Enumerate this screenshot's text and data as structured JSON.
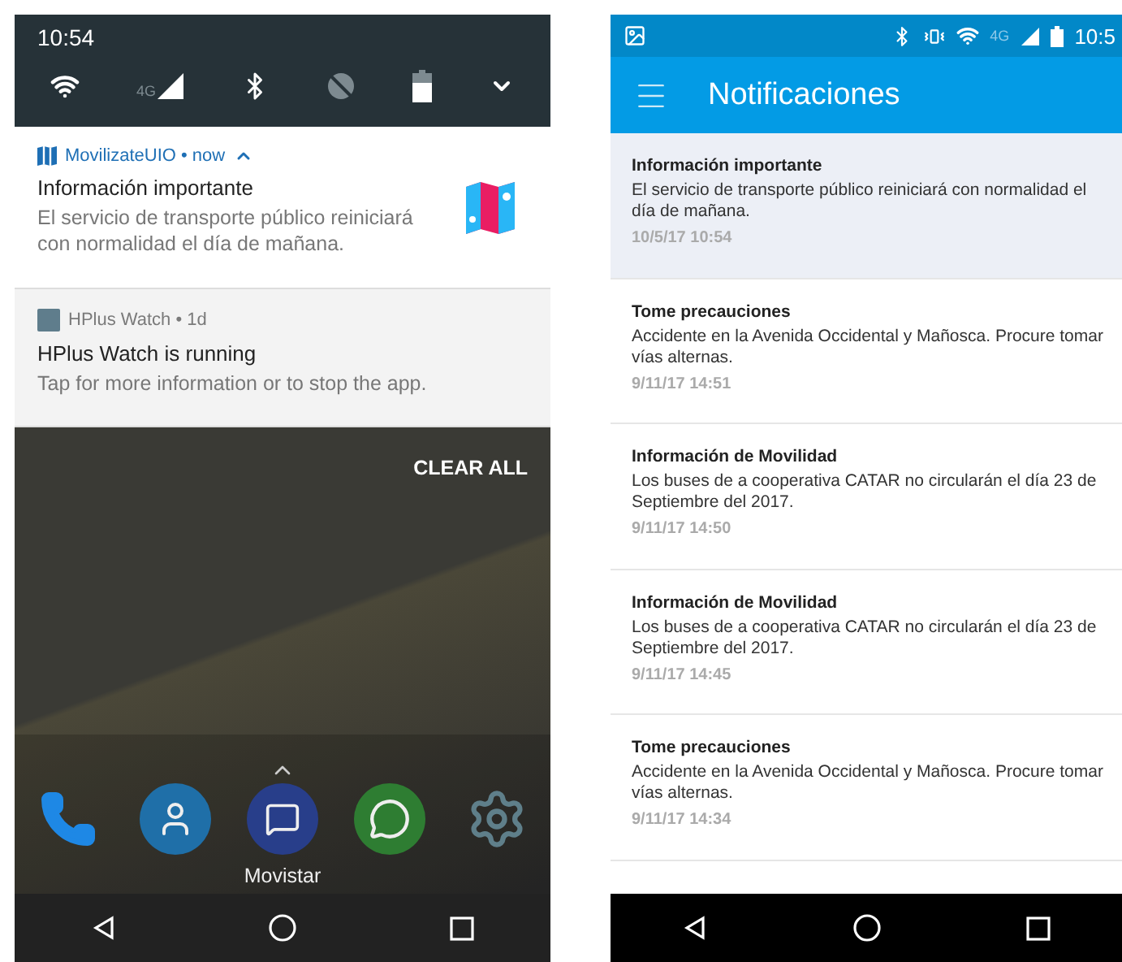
{
  "left_phone": {
    "status_bar": {
      "time": "10:54",
      "network": "4G"
    },
    "notifications": [
      {
        "header": "MovilizateUIO • now",
        "title": "Información importante",
        "body": "El servicio de transporte público reiniciará con normalidad el día de mañana.",
        "expanded": true
      },
      {
        "header": "HPlus Watch • 1d",
        "title": "HPlus Watch is running",
        "body": "Tap for more information or to stop the app.",
        "expanded": false
      }
    ],
    "clear_all": "CLEAR ALL",
    "dock_label": "Movistar"
  },
  "right_phone": {
    "status_bar": {
      "network": "4G",
      "time": "10:5"
    },
    "app_bar": {
      "title": "Notificaciones"
    },
    "items": [
      {
        "title": "Información importante",
        "body": "El servicio de transporte público reiniciará con normalidad el día de mañana.",
        "date": "10/5/17 10:54",
        "selected": true
      },
      {
        "title": "Tome precauciones",
        "body": "Accidente en la Avenida Occidental y Mañosca. Procure tomar vías alternas.",
        "date": "9/11/17 14:51",
        "selected": false
      },
      {
        "title": "Información de Movilidad",
        "body": "Los buses de a cooperativa CATAR no circularán el día 23 de Septiembre del 2017.",
        "date": "9/11/17 14:50",
        "selected": false
      },
      {
        "title": "Información de Movilidad",
        "body": "Los buses de a cooperativa CATAR no circularán el día 23 de Septiembre del 2017.",
        "date": "9/11/17 14:45",
        "selected": false
      },
      {
        "title": "Tome precauciones",
        "body": "Accidente en la Avenida Occidental y Mañosca. Procure tomar vías alternas.",
        "date": "9/11/17 14:34",
        "selected": false
      }
    ]
  }
}
